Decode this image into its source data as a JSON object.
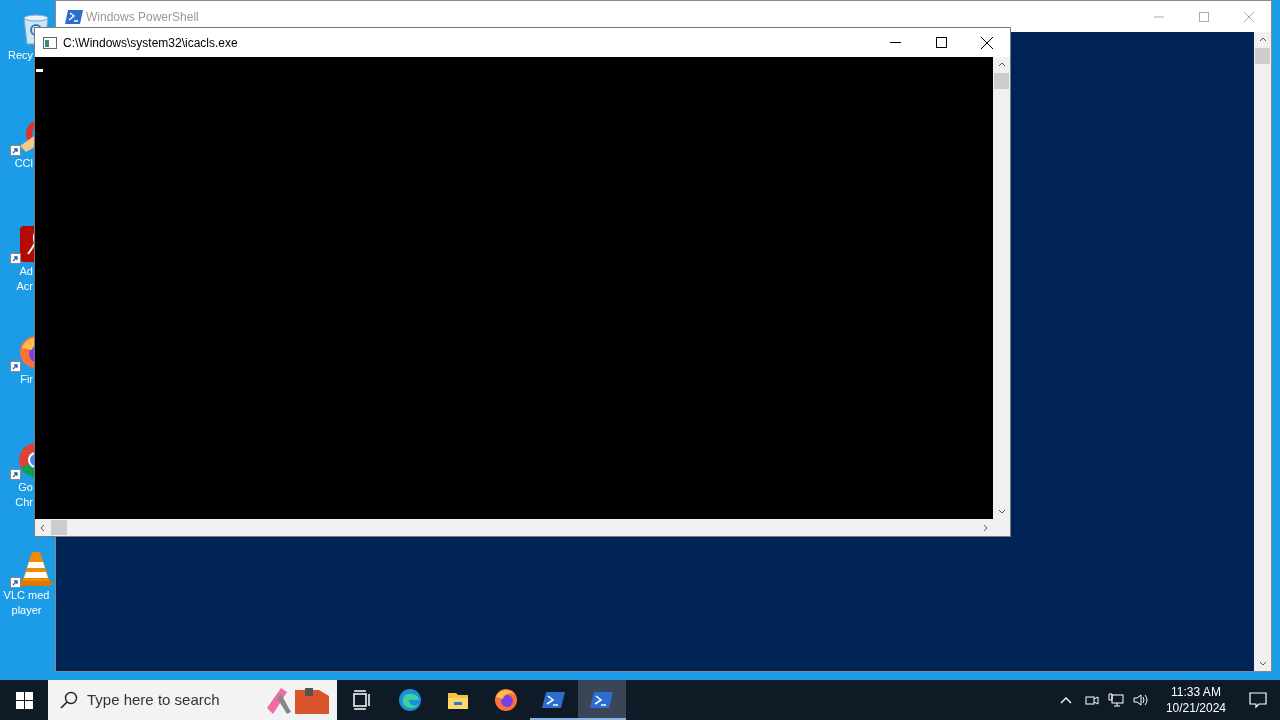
{
  "desktop_icons": [
    {
      "kind": "recycle",
      "label": [
        "Recy"
      ]
    },
    {
      "kind": "ccleaner",
      "label": [
        "CCl"
      ]
    },
    {
      "kind": "acrobat",
      "label": [
        "Ad",
        "Acr"
      ]
    },
    {
      "kind": "firefox",
      "label": [
        "Fir"
      ]
    },
    {
      "kind": "chrome",
      "label": [
        "Go",
        "Chr"
      ]
    },
    {
      "kind": "vlc",
      "label": [
        "VLC med",
        "player"
      ]
    }
  ],
  "back_window": {
    "title": "Windows PowerShell",
    "active": false
  },
  "front_window": {
    "title": "C:\\Windows\\system32\\icacls.exe",
    "active": true,
    "cursor": true
  },
  "taskbar": {
    "search": {
      "placeholder": "Type here to search"
    },
    "apps": [
      {
        "kind": "taskview",
        "selected": false,
        "running": false
      },
      {
        "kind": "edge",
        "selected": false,
        "running": false
      },
      {
        "kind": "explorer",
        "selected": false,
        "running": false
      },
      {
        "kind": "firefox",
        "selected": false,
        "running": false
      },
      {
        "kind": "powershell",
        "selected": false,
        "running": true
      },
      {
        "kind": "powershell",
        "selected": true,
        "running": true
      }
    ],
    "time": "11:33 AM",
    "date": "10/21/2024"
  }
}
